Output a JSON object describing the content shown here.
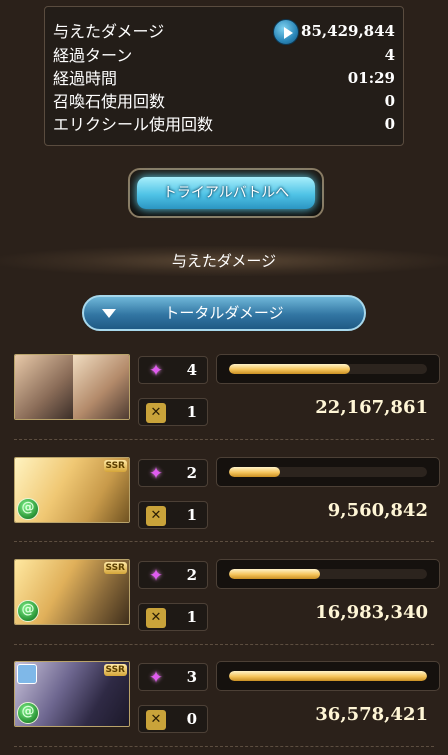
{
  "stats": {
    "rows": [
      {
        "label": "与えたダメージ",
        "value": "85,429,844"
      },
      {
        "label": "経過ターン",
        "value": "4"
      },
      {
        "label": "経過時間",
        "value": "01:29"
      },
      {
        "label": "召喚石使用回数",
        "value": "0"
      },
      {
        "label": "エリクシール使用回数",
        "value": "0"
      }
    ]
  },
  "trial_button": {
    "label": "トライアルバトルへ"
  },
  "section": {
    "title": "与えたダメージ"
  },
  "dropdown": {
    "label": "トータルダメージ"
  },
  "characters": [
    {
      "stars": "4",
      "ougi": "1",
      "damage": "22,167,861",
      "bar_fraction": 0.61,
      "element": "none"
    },
    {
      "stars": "2",
      "ougi": "1",
      "damage": "9,560,842",
      "bar_fraction": 0.26,
      "element": "wind"
    },
    {
      "stars": "2",
      "ougi": "1",
      "damage": "16,983,340",
      "bar_fraction": 0.46,
      "element": "wind"
    },
    {
      "stars": "3",
      "ougi": "0",
      "damage": "36,578,421",
      "bar_fraction": 1.0,
      "element": "wind"
    }
  ],
  "portrait_badges": [
    "SSR",
    "SSR",
    "SSR"
  ],
  "colors": {
    "accent_blue": "#4fc3e6",
    "bar_gold": "#f5c45b",
    "wind": "#2e9a3a"
  },
  "icons": [
    "play-icon",
    "star-icon",
    "ougi-icon",
    "wind-element-icon",
    "chevron-down-icon"
  ]
}
